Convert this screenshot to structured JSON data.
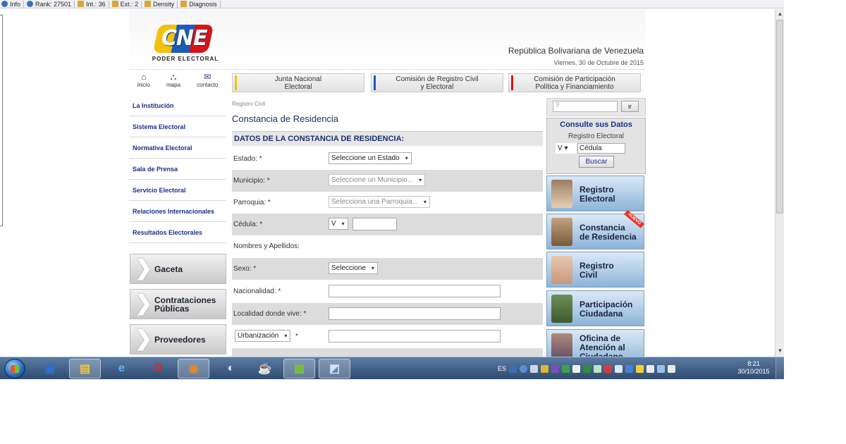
{
  "infobar": {
    "items": [
      {
        "label": "Info"
      },
      {
        "label": "Rank: 27501"
      },
      {
        "label": "Int.: 36"
      },
      {
        "label": "Ext.: 2"
      },
      {
        "label": "Density"
      },
      {
        "label": "Diagnosis"
      }
    ]
  },
  "header": {
    "logo_text": "CNE",
    "logo_subtitle": "PODER ELECTORAL",
    "country": "República Bolivariana de Venezuela",
    "date": "Viernes, 30 de Octubre de 2015"
  },
  "quicklinks": [
    {
      "label": "inicio",
      "icon": "home-icon",
      "glyph": "⌂"
    },
    {
      "label": "mapa",
      "icon": "sitemap-icon",
      "glyph": "⛬"
    },
    {
      "label": "contacto",
      "icon": "mail-icon",
      "glyph": "✉"
    }
  ],
  "toptabs": [
    {
      "line1": "Junta Nacional",
      "line2": "Electoral",
      "color": "#f2c20b"
    },
    {
      "line1": "Comisión de Registro Civil",
      "line2": "y Electoral",
      "color": "#1d5bb8"
    },
    {
      "line1": "Comisión de Participación",
      "line2": "Política y Financiamiento",
      "color": "#d6151b"
    }
  ],
  "leftmenu": [
    {
      "label": "La Institución"
    },
    {
      "label": "Sistema Electoral"
    },
    {
      "label": "Normativa Electoral"
    },
    {
      "label": "Sala de Prensa"
    },
    {
      "label": "Servicio Electoral"
    },
    {
      "label": "Relaciones Internacionales"
    },
    {
      "label": "Resultados Electorales"
    }
  ],
  "leftbuttons": [
    {
      "line1": "Gaceta",
      "line2": ""
    },
    {
      "line1": "Contrataciones",
      "line2": "Públicas"
    },
    {
      "line1": "Proveedores",
      "line2": ""
    }
  ],
  "content": {
    "breadcrumb": "Registro Civil",
    "title": "Constancia de Residencia",
    "section": "DATOS DE LA CONSTANCIA DE RESIDENCIA:",
    "fields": {
      "estado_label": "Estado: *",
      "estado_value": "Seleccione un Estado",
      "municipio_label": "Municipio: *",
      "municipio_value": "Seleccione un Municipio...",
      "parroquia_label": "Parroquia: *",
      "parroquia_value": "Selecciona una Parroquia...",
      "cedula_label": "Cédula: *",
      "cedula_type": "V",
      "nombres_label": "Nombres y Apellidos:",
      "sexo_label": "Sexo: *",
      "sexo_value": "Seleccione",
      "nacionalidad_label": "Nacionalidad: *",
      "localidad_label": "Localidad donde vive: *",
      "urbanizacion_value": "Urbanización",
      "urbanizacion_req": "*"
    }
  },
  "sidebar": {
    "search_button": "ir",
    "consulte_title": "Consulte sus Datos",
    "consulte_subtitle": "Registro Electoral",
    "consulte_type": "V",
    "consulte_placeholder": "Cédula",
    "consulte_button": "Buscar",
    "tiles": [
      {
        "line1": "Registro",
        "line2": "Electoral",
        "badge": ""
      },
      {
        "line1": "Constancia",
        "line2": "de Residencia",
        "badge": "NUEVO"
      },
      {
        "line1": "Registro",
        "line2": "Civil",
        "badge": ""
      },
      {
        "line1": "Participación",
        "line2": "Ciudadana",
        "badge": ""
      },
      {
        "line1": "Oficina de",
        "line2": "Atención al Ciudadano",
        "badge": ""
      }
    ]
  },
  "taskbar": {
    "lang": "ES",
    "time": "8:21",
    "date": "30/10/2015"
  }
}
